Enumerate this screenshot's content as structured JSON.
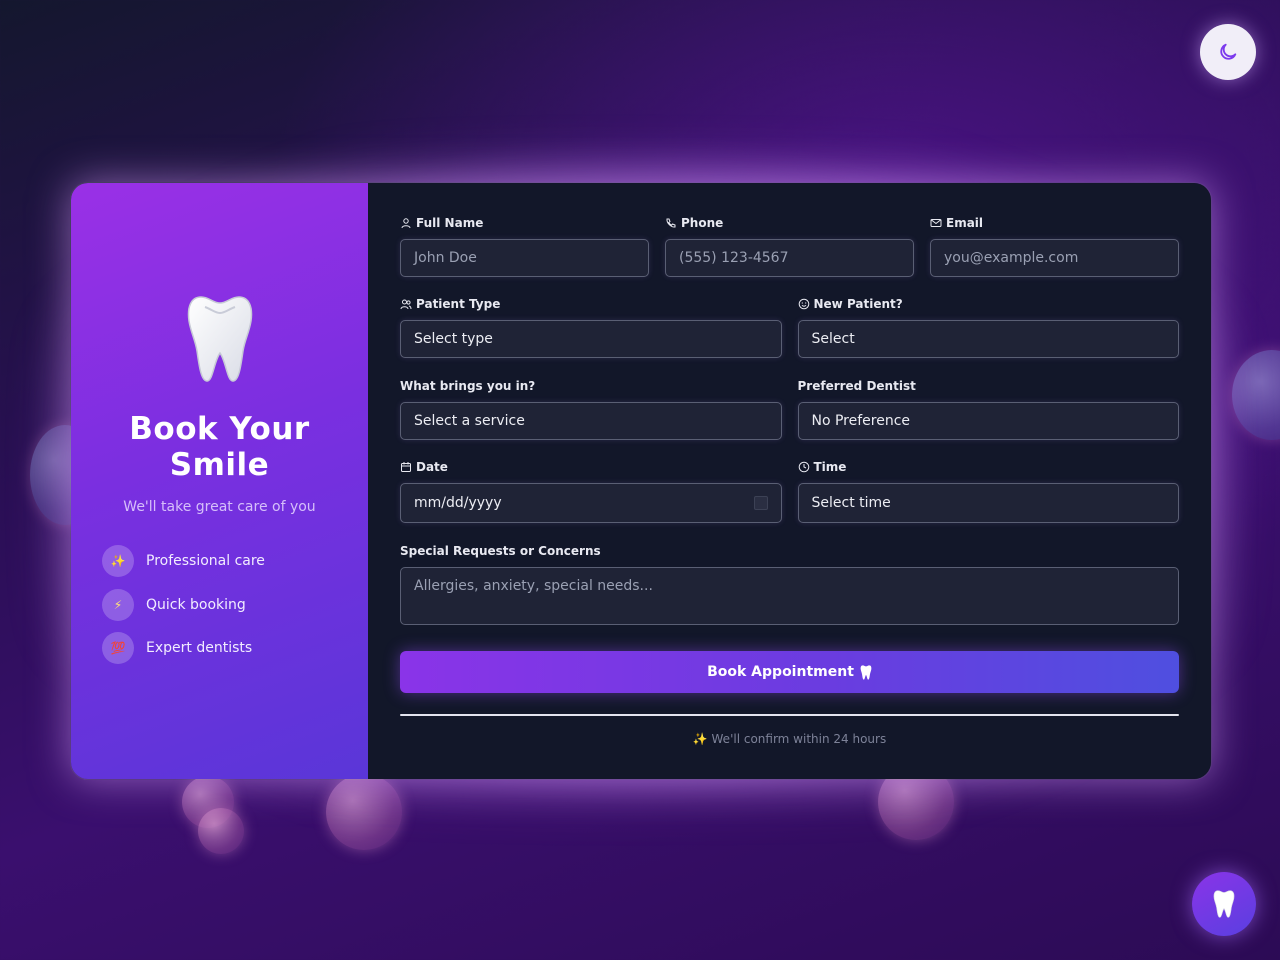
{
  "brand": {
    "title": "Book Your Smile",
    "subtitle": "We'll take great care of you",
    "features": [
      {
        "icon": "sparkles-icon",
        "glyph": "✨",
        "label": "Professional care"
      },
      {
        "icon": "lightning-icon",
        "glyph": "⚡",
        "label": "Quick booking"
      },
      {
        "icon": "hundred-icon",
        "glyph": "💯",
        "label": "Expert dentists"
      }
    ]
  },
  "form": {
    "full_name": {
      "label": "Full Name",
      "placeholder": "John Doe"
    },
    "phone": {
      "label": "Phone",
      "placeholder": "(555) 123-4567"
    },
    "email": {
      "label": "Email",
      "placeholder": "you@example.com"
    },
    "patient_type": {
      "label": "Patient Type",
      "value": "Select type"
    },
    "new_patient": {
      "label": "New Patient?",
      "value": "Select"
    },
    "service": {
      "label": "What brings you in?",
      "value": "Select a service"
    },
    "dentist": {
      "label": "Preferred Dentist",
      "value": "No Preference"
    },
    "date": {
      "label": "Date",
      "value": "mm/dd/yyyy"
    },
    "time": {
      "label": "Time",
      "value": "Select time"
    },
    "requests": {
      "label": "Special Requests or Concerns",
      "placeholder": "Allergies, anxiety, special needs..."
    },
    "submit_label": "Book Appointment",
    "confirm_note": "✨ We'll confirm within 24 hours"
  },
  "colors": {
    "accent_start": "#8a34e8",
    "accent_end": "#4f4fe0",
    "panel_bg": "#121729"
  }
}
